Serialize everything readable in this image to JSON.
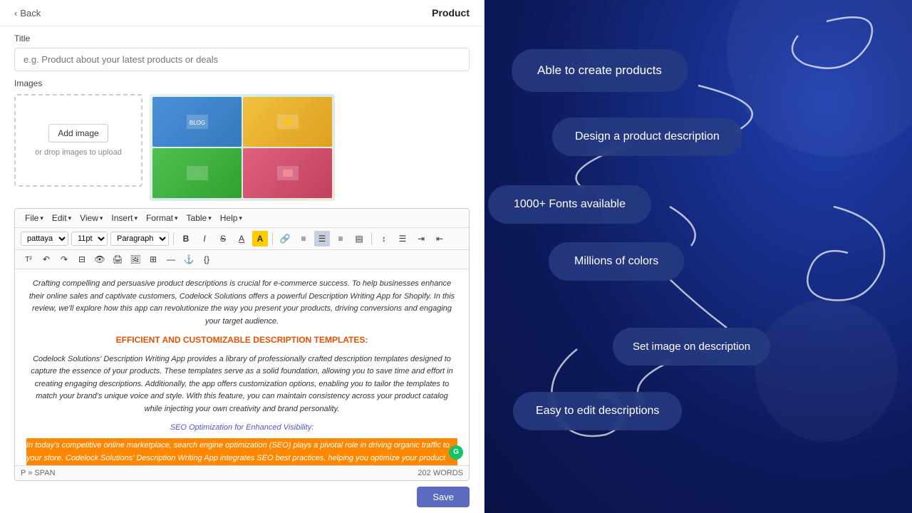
{
  "topbar": {
    "back_label": "Back",
    "product_label": "Product"
  },
  "title_section": {
    "label": "Title",
    "placeholder": "e.g. Product about your latest products or deals"
  },
  "images_section": {
    "label": "Images",
    "add_image_btn": "Add image",
    "drop_text": "or drop images to upload"
  },
  "menu_bar": {
    "items": [
      {
        "label": "File"
      },
      {
        "label": "Edit"
      },
      {
        "label": "View"
      },
      {
        "label": "Insert"
      },
      {
        "label": "Format"
      },
      {
        "label": "Table"
      },
      {
        "label": "Help"
      }
    ]
  },
  "toolbar": {
    "font": "pattaya",
    "size": "11pt",
    "paragraph": "Paragraph",
    "bold": "B",
    "italic": "I",
    "strikethrough": "S",
    "font_color": "A",
    "highlight": "A"
  },
  "editor": {
    "paragraph1": "Crafting compelling and persuasive product descriptions is crucial for e-commerce success. To help businesses enhance their online sales and captivate customers, Codelock Solutions offers a powerful Description Writing App for Shopify. In this review, we'll explore how this app can revolutionize the way you present your products, driving conversions and engaging your target audience.",
    "heading": "Efficient and Customizable Description Templates:",
    "paragraph2": "Codelock Solutions' Description Writing App provides a library of professionally crafted description templates designed to capture the essence of your products. These templates serve as a solid foundation, allowing you to save time and effort in creating engaging descriptions. Additionally, the app offers customization options, enabling you to tailor the templates to match your brand's unique voice and style. With this feature, you can maintain consistency across your product catalog while injecting your own creativity and brand personality.",
    "subheading": "SEO Optimization for Enhanced Visibility:",
    "highlighted": "In today's competitive online marketplace, search engine optimization (SEO) plays a pivotal role in driving organic traffic to your store. Codelock Solutions' Description Writing App integrates SEO best practices, helping you optimize your product descriptions for search engines. By including relevant keywords..."
  },
  "status_bar": {
    "path": "P » SPAN",
    "word_count": "202 WORDS"
  },
  "save_btn": "Save",
  "right_panel": {
    "features": [
      {
        "label": "Able to create products",
        "id": "create"
      },
      {
        "label": "Design a product description",
        "id": "design"
      },
      {
        "label": "1000+ Fonts available",
        "id": "fonts"
      },
      {
        "label": "Millions of colors",
        "id": "colors"
      },
      {
        "label": "Set image on description",
        "id": "image"
      },
      {
        "label": "Easy to edit descriptions",
        "id": "edit"
      }
    ]
  }
}
